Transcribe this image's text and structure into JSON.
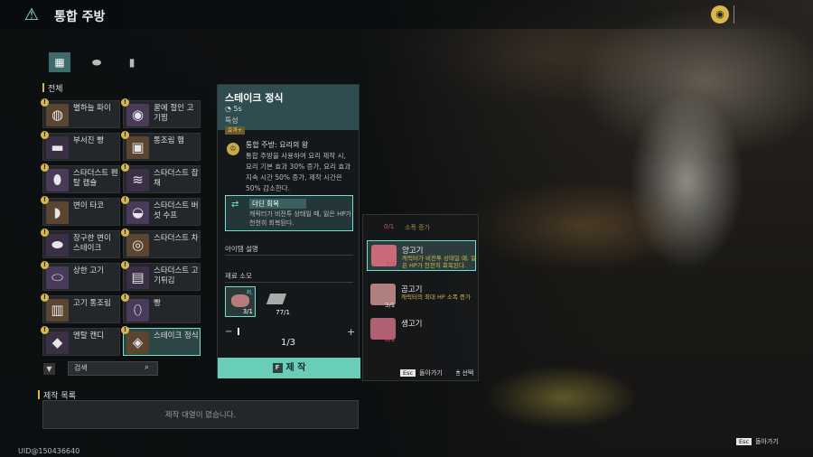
{
  "header": {
    "title": "통합 주방",
    "logo_icon": "warning-triangle-icon",
    "currency_icon": "coin-icon"
  },
  "tabs": [
    {
      "icon": "grid-icon",
      "selected": true
    },
    {
      "icon": "meat-icon"
    },
    {
      "icon": "bottle-icon"
    }
  ],
  "category": "전체",
  "recipes": [
    {
      "name": "별하늘 파이",
      "icon": "pie-icon"
    },
    {
      "name": "꿀에 절인 고기찜",
      "icon": "stew-icon"
    },
    {
      "name": "부서진 빵",
      "icon": "bread-icon"
    },
    {
      "name": "통조림 햄",
      "icon": "can-icon"
    },
    {
      "name": "스타더스트 펜탈 캡슐",
      "icon": "capsule-icon"
    },
    {
      "name": "스타더스트 잡채",
      "icon": "noodle-icon"
    },
    {
      "name": "변이 타코",
      "icon": "taco-icon"
    },
    {
      "name": "스타더스트 버섯 수프",
      "icon": "soup-icon"
    },
    {
      "name": "장구한 변이 스테이크",
      "icon": "steak-icon"
    },
    {
      "name": "스타더스트 차",
      "icon": "tea-icon"
    },
    {
      "name": "상한 고기",
      "icon": "rotten-meat-icon"
    },
    {
      "name": "스타더스트 고기튀김",
      "icon": "fried-icon"
    },
    {
      "name": "고기 통조림",
      "icon": "meat-can-icon"
    },
    {
      "name": "빵",
      "icon": "loaf-icon"
    },
    {
      "name": "엔탈 캔디",
      "icon": "candy-icon"
    },
    {
      "name": "스테이크 정식",
      "icon": "steak-set-icon",
      "selected": true
    }
  ],
  "search": {
    "placeholder": "검색"
  },
  "queue": {
    "title": "제작 목록",
    "empty": "제작 대열이 없습니다."
  },
  "uid": "UID@150436640",
  "detail": {
    "title": "스테이크 정식",
    "time": "5s",
    "trait_label": "특성",
    "badge": "효과+",
    "effect_title": "통합 주방: 요리의 왕",
    "effect_desc": "통합 주방을 사용하여 요리 제작 시, 요리 기본 효과 30% 증가, 요리 효과 지속 시간 50% 증가, 제작 시간은 50% 감소한다.",
    "buff_title": "더딘 회복",
    "buff_desc": "캐릭터가 비전투 상태일 때, 잃은 HP가 천천히 회복된다.",
    "info_label": "아이템 설명",
    "material_label": "재료 소모",
    "materials": [
      {
        "count": "3/1",
        "tag": "저."
      },
      {
        "count": "77/1"
      }
    ],
    "page": "1/3",
    "minus": "−",
    "plus": "+",
    "craft_key": "F",
    "craft_label": "제 작"
  },
  "popup": {
    "top_count": "0/1",
    "top_text": "소폭 증가",
    "options": [
      {
        "name": "양고기",
        "desc": "캐릭터가 비전투 상태일 때, 잃은 HP가 천천히 회복된다.",
        "count": "0/1",
        "color": "#c86a78"
      },
      {
        "name": "곰고기",
        "desc": "캐릭터의 최대 HP 소폭 증가",
        "count": "3/1",
        "color": "#b08080"
      },
      {
        "name": "생고기",
        "desc": "",
        "count": "0/1",
        "color": "#b06070"
      }
    ],
    "esc_key": "Esc",
    "back_label": "돌아가기",
    "select_label": "선택"
  },
  "footer": {
    "esc_key": "Esc",
    "back_label": "돌아가기"
  }
}
